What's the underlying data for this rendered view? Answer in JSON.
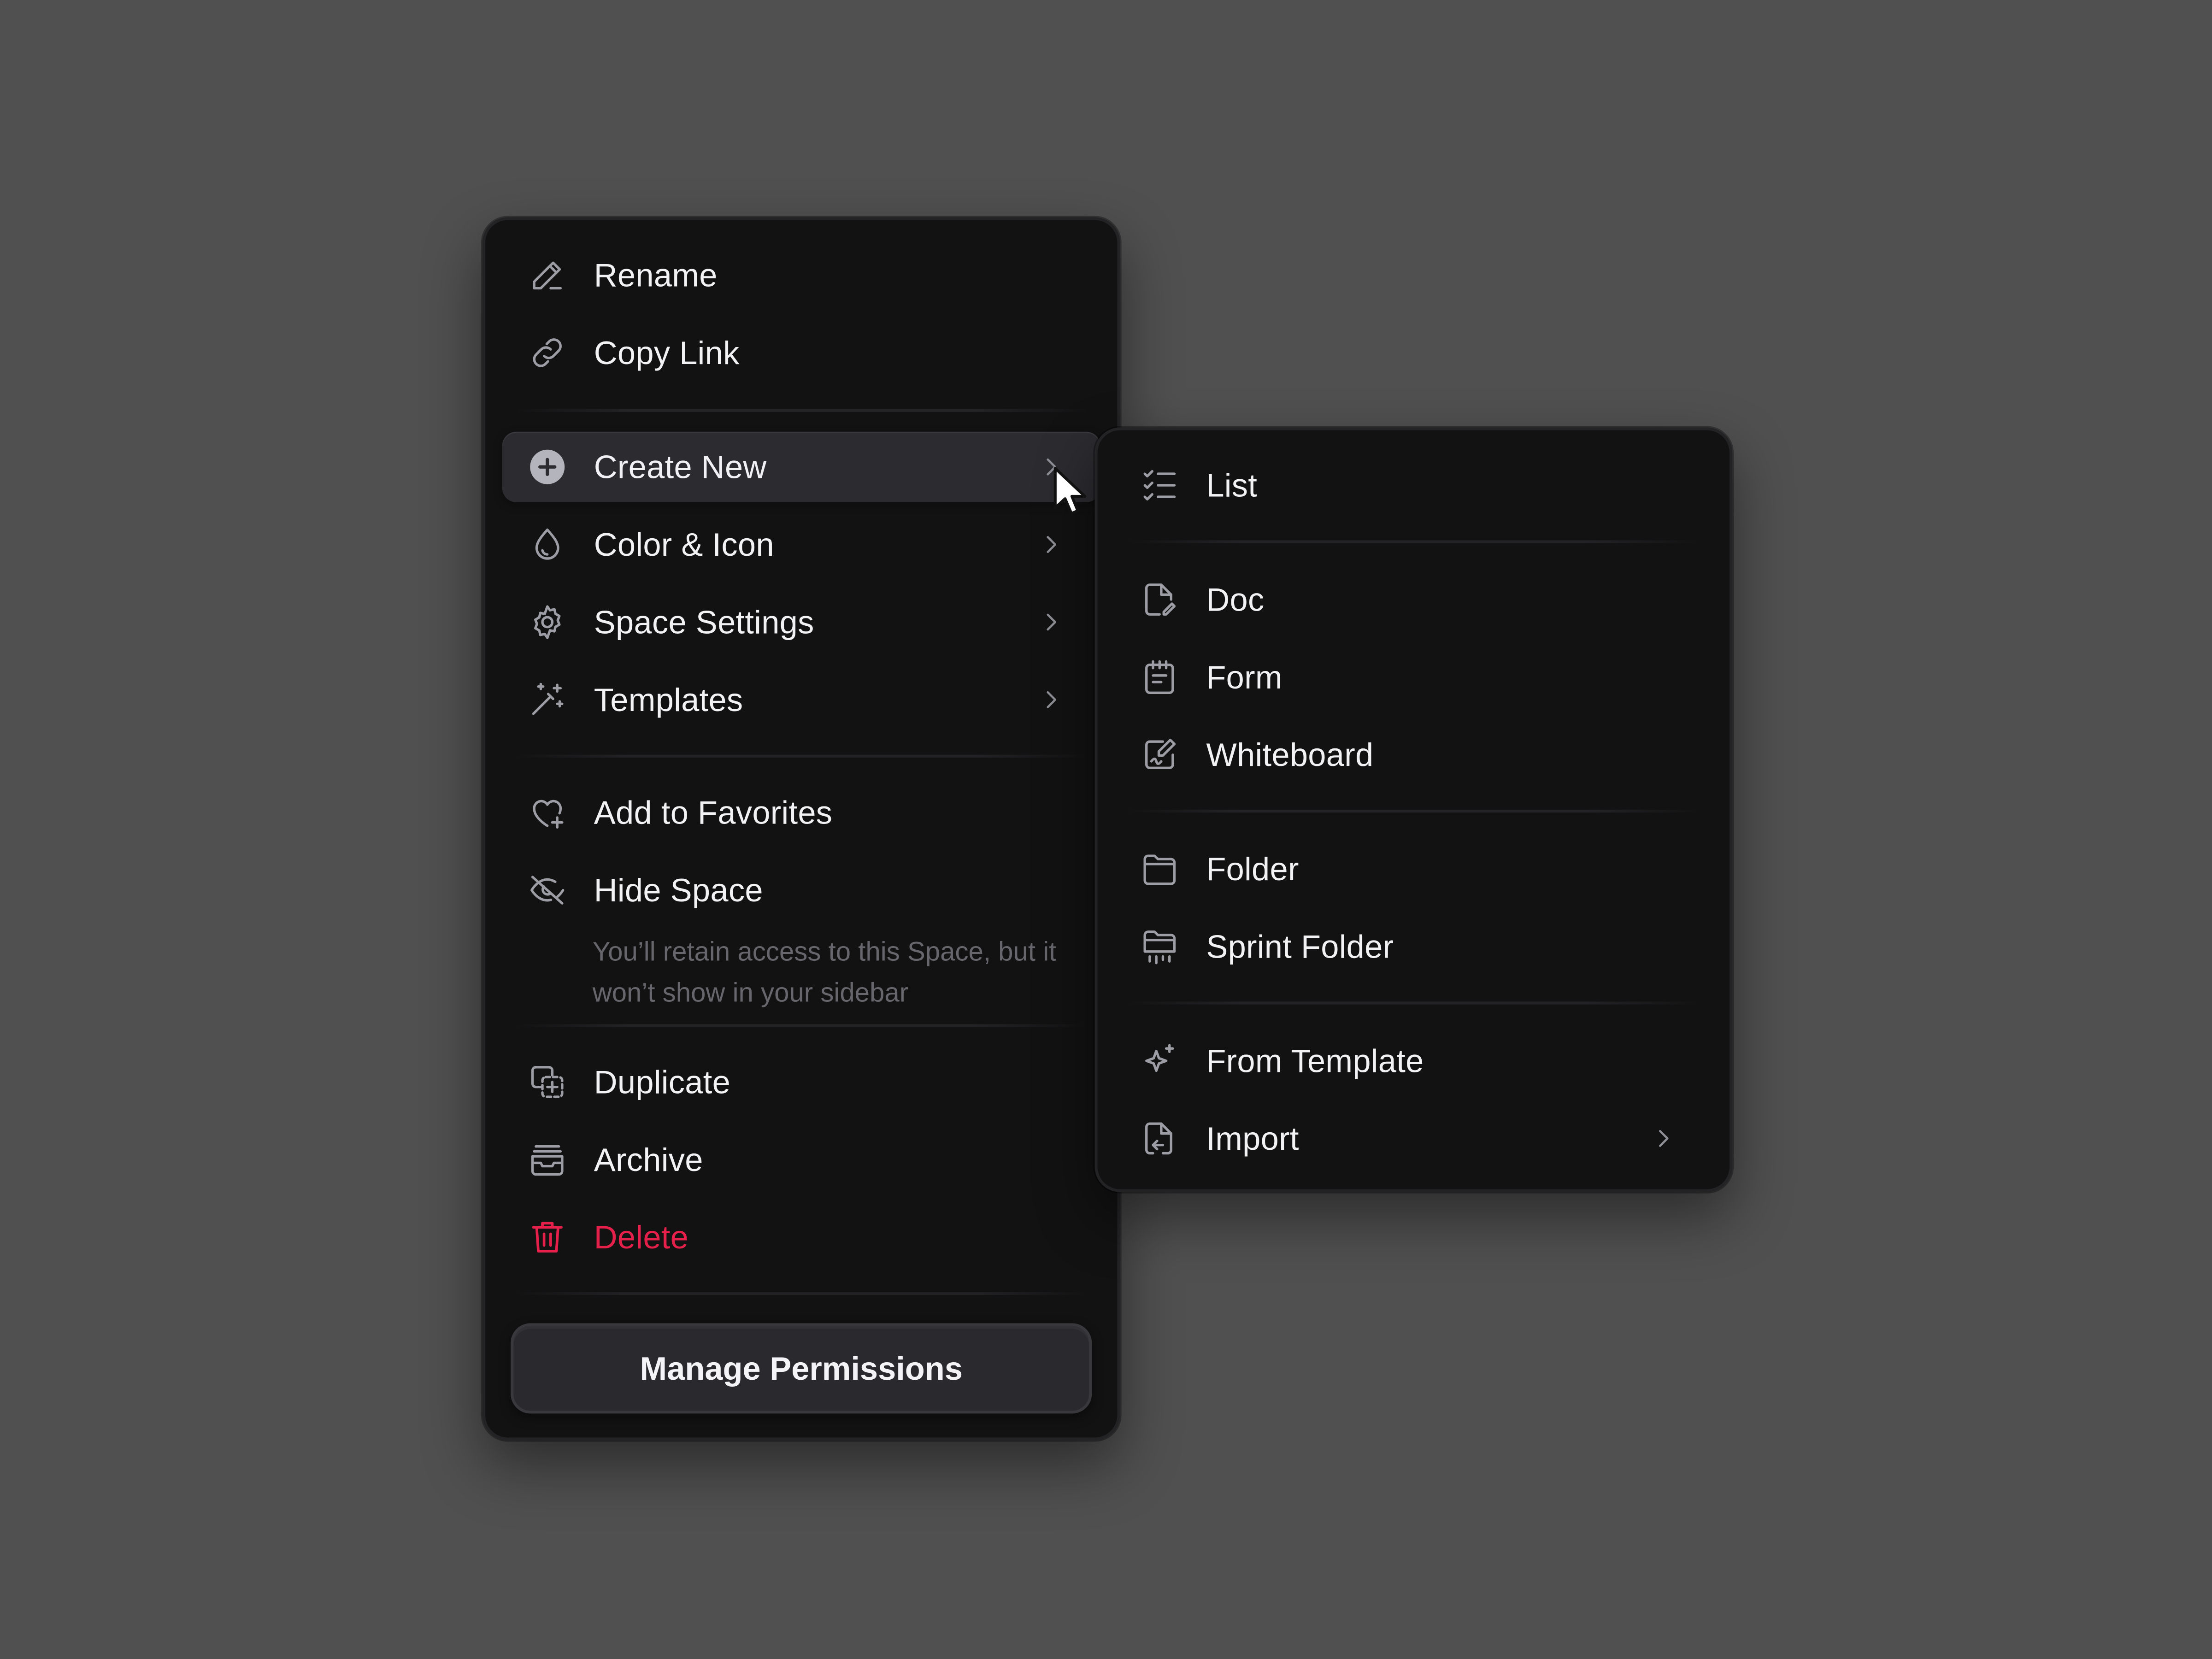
{
  "main_menu": {
    "items": [
      {
        "label": "Rename",
        "icon": "pencil-icon"
      },
      {
        "label": "Copy Link",
        "icon": "link-icon"
      },
      {
        "label": "Create New",
        "icon": "plus-circle-icon",
        "submenu": true,
        "active": true
      },
      {
        "label": "Color & Icon",
        "icon": "drop-icon",
        "submenu": true
      },
      {
        "label": "Space Settings",
        "icon": "gear-icon",
        "submenu": true
      },
      {
        "label": "Templates",
        "icon": "magic-wand-icon",
        "submenu": true
      },
      {
        "label": "Add to Favorites",
        "icon": "heart-plus-icon"
      },
      {
        "label": "Hide Space",
        "icon": "eye-off-icon"
      },
      {
        "label": "Duplicate",
        "icon": "duplicate-icon"
      },
      {
        "label": "Archive",
        "icon": "archive-icon"
      },
      {
        "label": "Delete",
        "icon": "trash-icon",
        "danger": true
      }
    ],
    "hide_space_hint": "You’ll retain access to this Space, but it won’t show in your sidebar",
    "manage_permissions_label": "Manage Permissions"
  },
  "sub_menu": {
    "items": [
      {
        "label": "List",
        "icon": "list-check-icon"
      },
      {
        "label": "Doc",
        "icon": "doc-edit-icon"
      },
      {
        "label": "Form",
        "icon": "form-icon"
      },
      {
        "label": "Whiteboard",
        "icon": "whiteboard-icon"
      },
      {
        "label": "Folder",
        "icon": "folder-icon"
      },
      {
        "label": "Sprint Folder",
        "icon": "sprint-folder-icon"
      },
      {
        "label": "From Template",
        "icon": "sparkle-icon"
      },
      {
        "label": "Import",
        "icon": "import-file-icon",
        "submenu": true
      }
    ]
  },
  "colors": {
    "background": "#505050",
    "menu_bg": "#121213",
    "active_item_bg": "#2c2c30",
    "text": "#f2f2f4",
    "muted_text": "#66666c",
    "icon": "#9d9da5",
    "danger": "#e5204a"
  }
}
